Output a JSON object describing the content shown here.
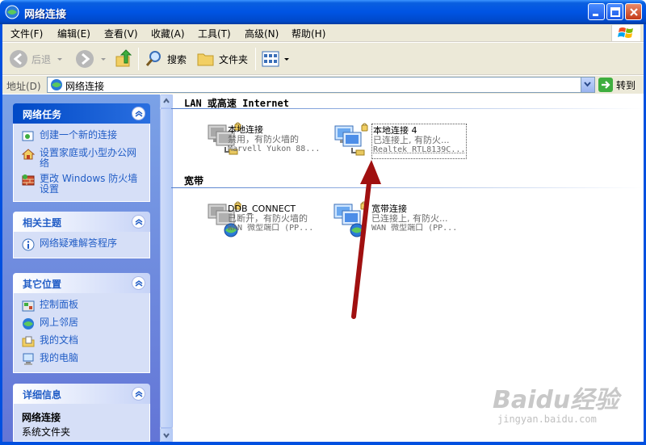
{
  "window": {
    "title": "网络连接"
  },
  "menu": [
    "文件(F)",
    "编辑(E)",
    "查看(V)",
    "收藏(A)",
    "工具(T)",
    "高级(N)",
    "帮助(H)"
  ],
  "toolbar": {
    "back_label": "后退",
    "search_label": "搜索",
    "folders_label": "文件夹"
  },
  "address": {
    "label": "地址(D)",
    "value": "网络连接",
    "go_label": "转到"
  },
  "tasks": {
    "network": {
      "title": "网络任务",
      "items": [
        "创建一个新的连接",
        "设置家庭或小型办公网络",
        "更改 Windows 防火墙设置"
      ]
    },
    "related": {
      "title": "相关主题",
      "items": [
        "网络疑难解答程序"
      ]
    },
    "other": {
      "title": "其它位置",
      "items": [
        "控制面板",
        "网上邻居",
        "我的文档",
        "我的电脑"
      ]
    },
    "details": {
      "title": "详细信息",
      "name": "网络连接",
      "type": "系统文件夹"
    }
  },
  "groups": {
    "lan": "LAN 或高速 Internet",
    "broadband": "宽带"
  },
  "connections": [
    {
      "name": "本地连接",
      "status": "禁用，有防火墙的",
      "device": "Marvell Yukon 88..."
    },
    {
      "name": "本地连接 4",
      "status": "已连接上, 有防火...",
      "device": "Realtek RTL8139C..."
    },
    {
      "name": "DDB_CONNECT",
      "status": "已断开，有防火墙的",
      "device": "WAN 微型端口 (PP..."
    },
    {
      "name": "宽带连接",
      "status": "已连接上, 有防火...",
      "device": "WAN 微型端口 (PP..."
    }
  ],
  "watermark": {
    "logo": "Baidu经验",
    "url": "jingyan.baidu.com"
  },
  "colors": {
    "title_blue": "#0054e3",
    "task_pane": "#6f8ad9",
    "link_blue": "#215dc6",
    "arrow_red": "#a01010"
  }
}
